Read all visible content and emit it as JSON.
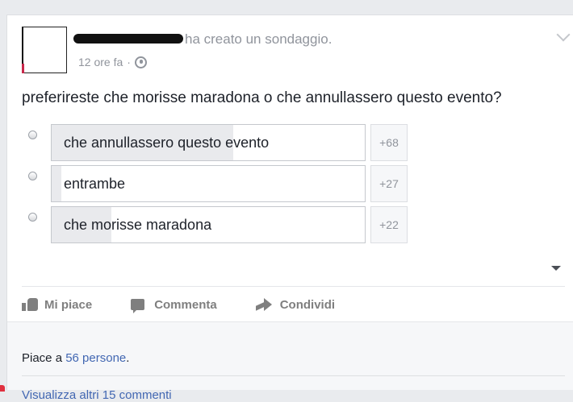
{
  "post": {
    "author_action": "ha creato un sondaggio.",
    "timestamp": "12 ore fa",
    "separator": "·",
    "privacy_icon": "globe-icon",
    "question": "preferireste che morisse maradona o che annullassero questo evento?"
  },
  "poll": {
    "options": [
      {
        "label": "che annullassero questo evento",
        "votes": "+68",
        "fill_fraction": 0.58
      },
      {
        "label": "entrambe",
        "votes": "+27",
        "fill_fraction": 0.03
      },
      {
        "label": "che morisse maradona",
        "votes": "+22",
        "fill_fraction": 0.19
      }
    ]
  },
  "actions": {
    "like": "Mi piace",
    "comment": "Commenta",
    "share": "Condividi"
  },
  "footer": {
    "likes_prefix": "Piace a ",
    "likes_count": "56 persone",
    "likes_suffix": ".",
    "more_comments": "Visualizza altri 15 commenti"
  },
  "colors": {
    "link": "#4267b2",
    "poll_fill": "#e9eaed",
    "background": "#e9ebee"
  }
}
